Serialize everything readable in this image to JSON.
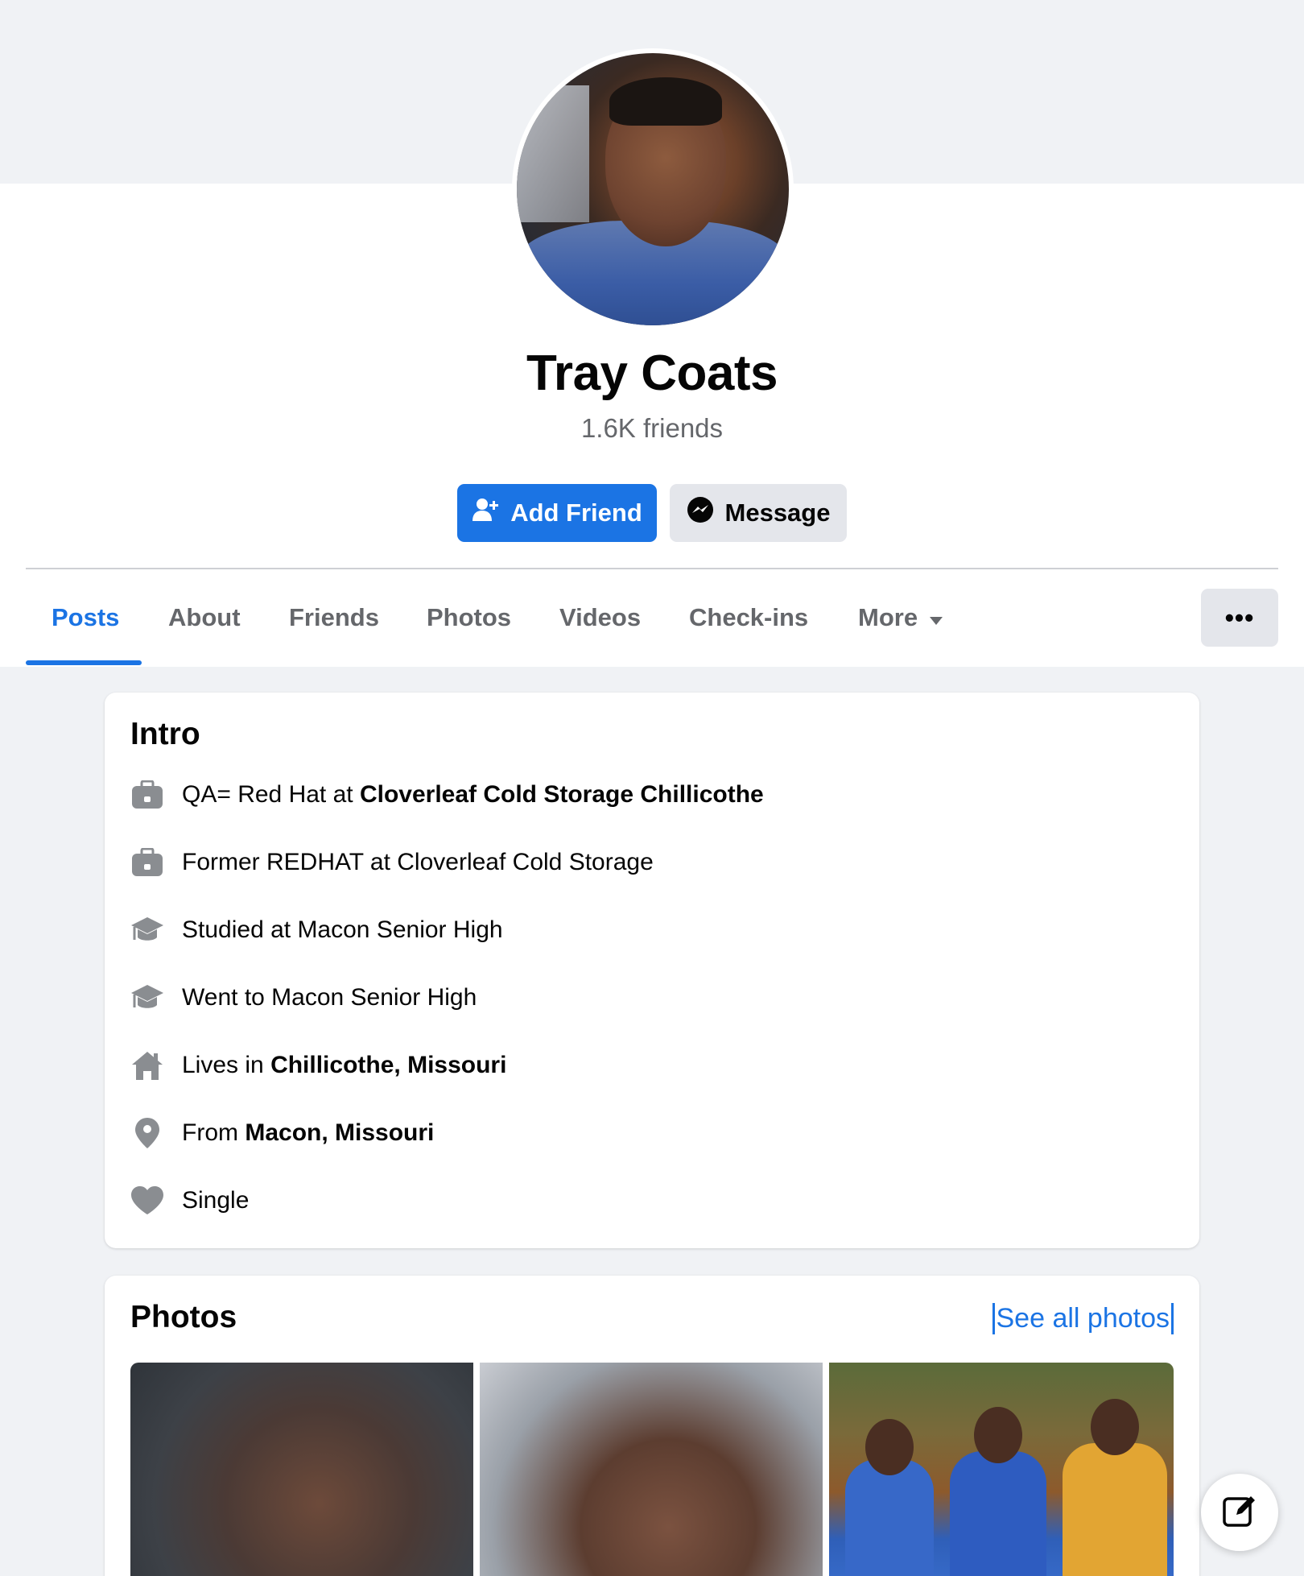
{
  "profile": {
    "name": "Tray Coats",
    "friends_count": "1.6K friends"
  },
  "actions": {
    "add_friend_label": "Add Friend",
    "message_label": "Message",
    "more_options_label": "•••"
  },
  "tabs": [
    {
      "label": "Posts",
      "active": true
    },
    {
      "label": "About"
    },
    {
      "label": "Friends"
    },
    {
      "label": "Photos"
    },
    {
      "label": "Videos"
    },
    {
      "label": "Check-ins"
    },
    {
      "label": "More"
    }
  ],
  "intro": {
    "title": "Intro",
    "items": [
      {
        "icon": "briefcase-icon",
        "prefix": "QA= Red Hat at ",
        "bold": "Cloverleaf Cold Storage Chillicothe"
      },
      {
        "icon": "briefcase-icon",
        "prefix": "Former REDHAT at Cloverleaf Cold Storage",
        "bold": ""
      },
      {
        "icon": "graduation-cap-icon",
        "prefix": "Studied at Macon Senior High",
        "bold": ""
      },
      {
        "icon": "graduation-cap-icon",
        "prefix": "Went to Macon Senior High",
        "bold": ""
      },
      {
        "icon": "home-icon",
        "prefix": "Lives in ",
        "bold": "Chillicothe, Missouri"
      },
      {
        "icon": "location-pin-icon",
        "prefix": "From ",
        "bold": "Macon, Missouri"
      },
      {
        "icon": "heart-icon",
        "prefix": "Single",
        "bold": ""
      }
    ]
  },
  "photos": {
    "title": "Photos",
    "see_all_label": "See all photos"
  },
  "colors": {
    "accent": "#1b74e4",
    "background": "#f0f2f5",
    "secondary_text": "#65676b",
    "icon_gray": "#8a8d91"
  }
}
